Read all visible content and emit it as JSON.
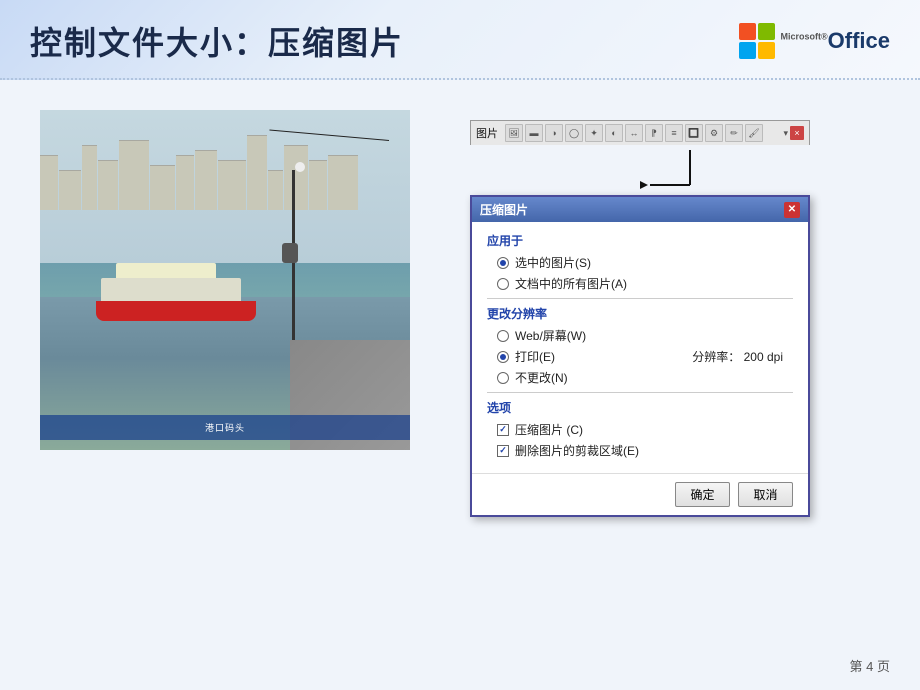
{
  "header": {
    "title": "控制文件大小：压缩图片",
    "office_label": "Office",
    "ms_label": "Microsoft®"
  },
  "toolbar": {
    "title": "图片",
    "close_symbol": "×",
    "icons": [
      "🖼",
      "▬",
      "◑",
      "◯",
      "✦",
      "◐",
      "↔",
      "⁋",
      "≡",
      "🖊",
      "🔲",
      "⚙",
      "✏",
      "🖌"
    ]
  },
  "dialog": {
    "title": "压缩图片",
    "close_symbol": "✕",
    "apply_section": "应用于",
    "radio_selected": "选中的图片(S)",
    "radio_all": "文档中的所有图片(A)",
    "resolution_section": "更改分辨率",
    "radio_web": "Web/屏幕(W)",
    "radio_print": "打印(E)",
    "radio_nochange": "不更改(N)",
    "dpi_label": "分辨率：",
    "dpi_value": "200 dpi",
    "options_section": "选项",
    "chk_compress": "压缩图片 (C)",
    "chk_delete": "删除图片的剪裁区域(E)",
    "btn_ok": "确定",
    "btn_cancel": "取消"
  },
  "page": {
    "number_label": "第 4 页"
  }
}
